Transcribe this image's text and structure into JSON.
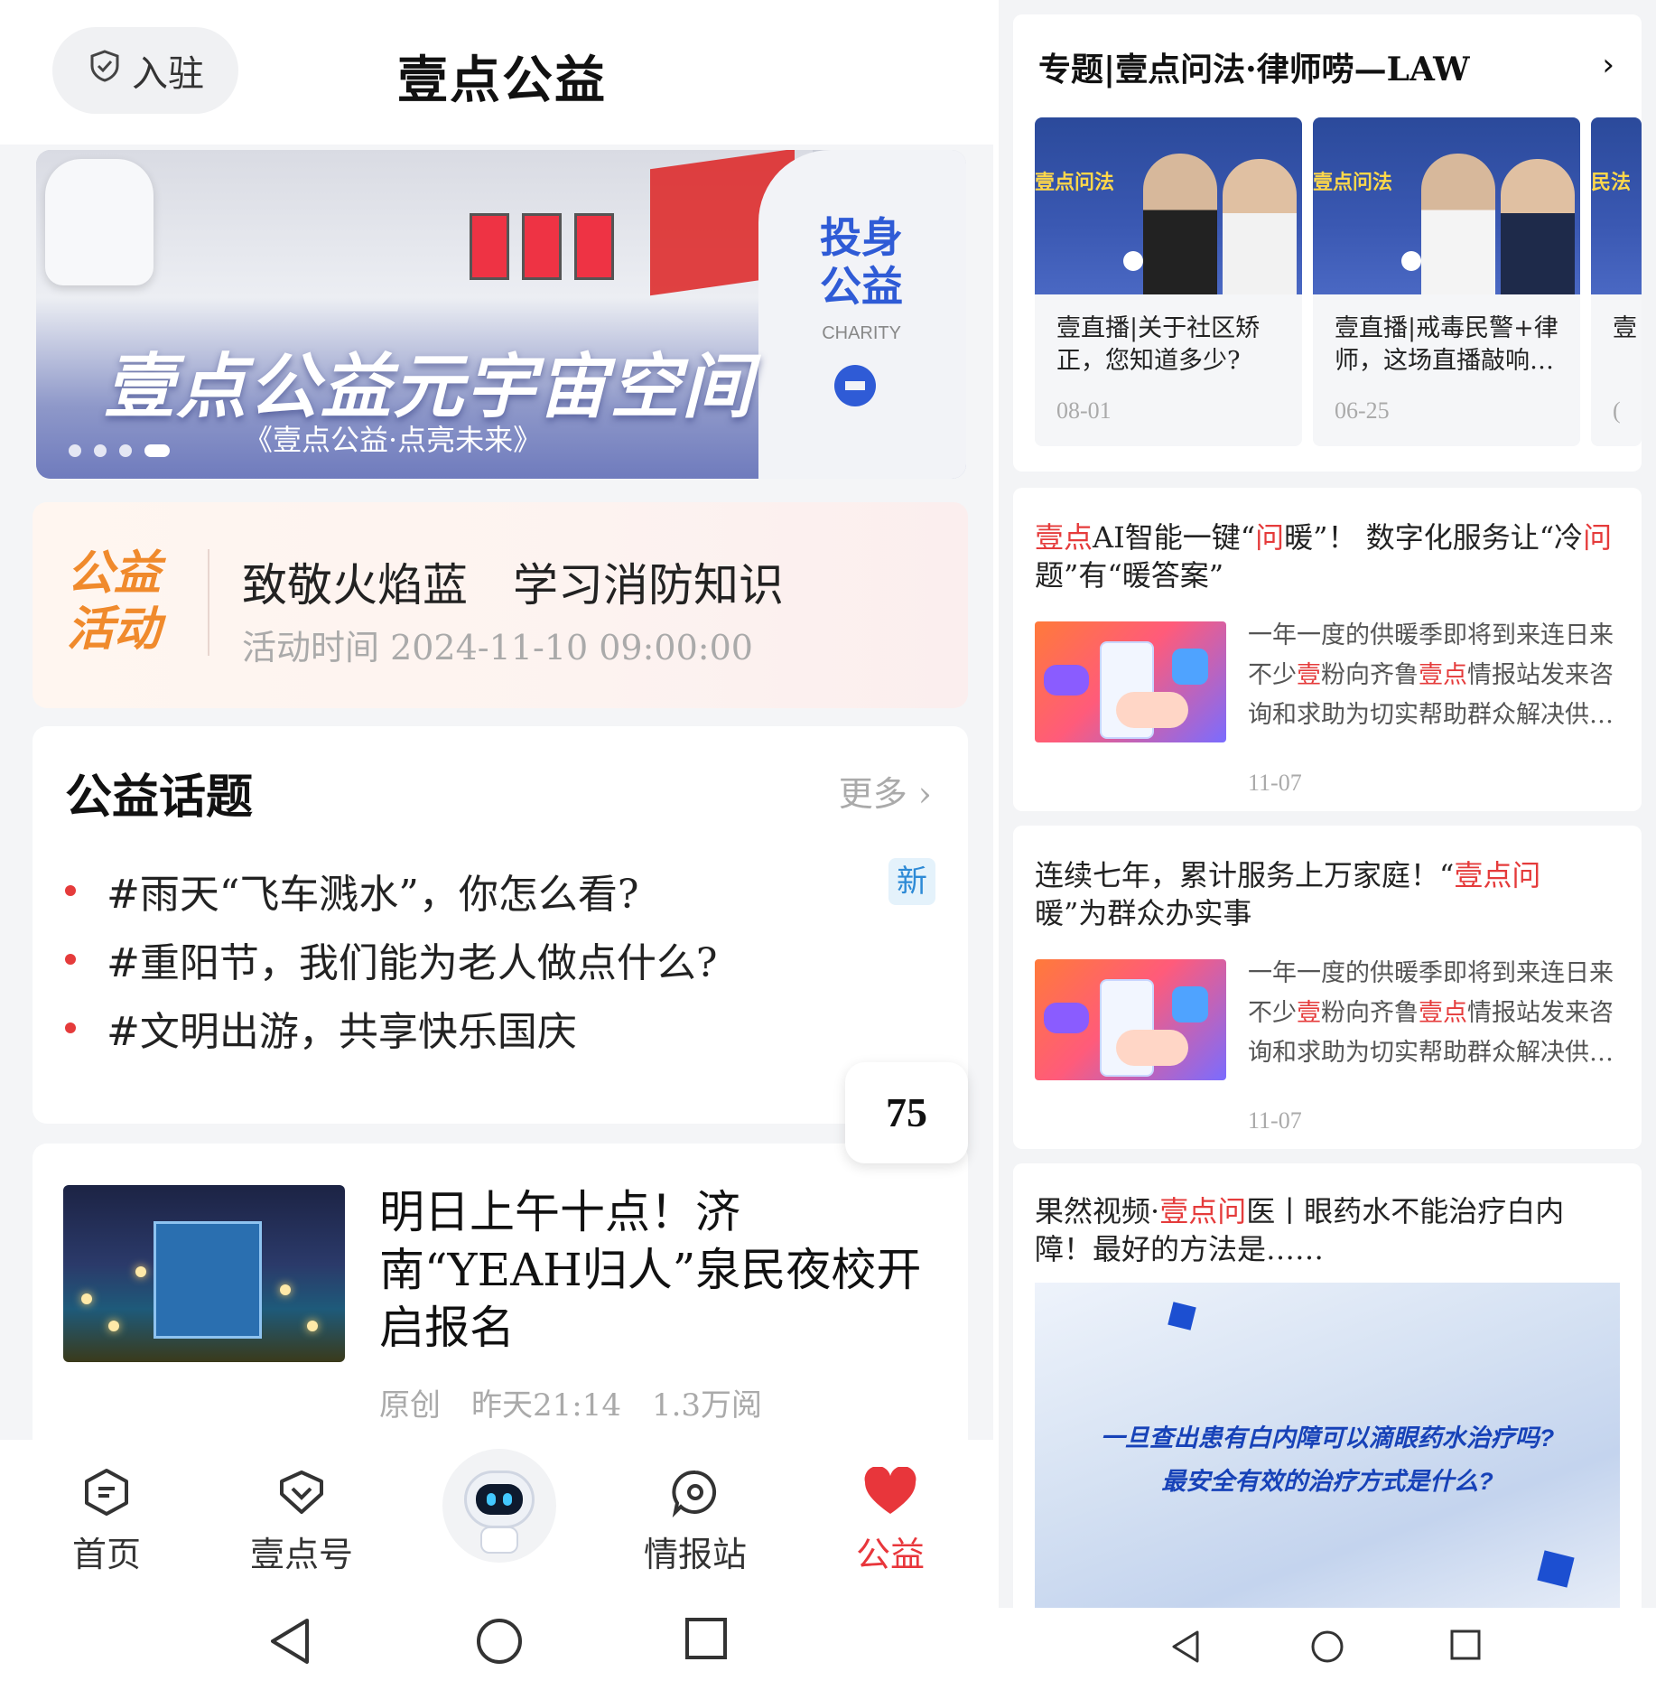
{
  "left": {
    "header": {
      "join_label": "入驻",
      "title": "壹点公益"
    },
    "banner": {
      "headline": "壹点公益元宇宙空间",
      "subtitle": "《壹点公益·点亮未来》",
      "side_title": "投身公益",
      "side_en": "CHARITY",
      "slides_total": 4,
      "active_slide": 4
    },
    "activity": {
      "tag": "公益活动",
      "title": "致敬火焰蓝　学习消防知识",
      "time": "活动时间 2024-11-10 09:00:00"
    },
    "topics": {
      "heading": "公益话题",
      "more": "更多",
      "new_badge": "新",
      "items": [
        "#雨天“飞车溅水”，你怎么看?",
        "#重阳节，我们能为老人做点什么?",
        "#文明出游，共享快乐国庆"
      ]
    },
    "bubble_count": "75",
    "news": {
      "title": "明日上午十点！济南“YEAH归人”泉民夜校开启报名",
      "meta": "原创　昨天21:14　1.3万阅"
    },
    "tabbar": [
      {
        "label": "首页",
        "icon": "home-icon"
      },
      {
        "label": "壹点号",
        "icon": "heart-shield-icon"
      },
      {
        "label": "",
        "icon": "robot-icon"
      },
      {
        "label": "情报站",
        "icon": "message-circle-icon"
      },
      {
        "label": "公益",
        "icon": "heart-icon"
      }
    ],
    "colors": {
      "accent": "#e8363b",
      "orange": "#f08a2c",
      "blue": "#2f5bd6"
    }
  },
  "right": {
    "topic_card": {
      "heading": "专题|壹点问法·律师唠—LAW",
      "videos": [
        {
          "thumb_label": "壹点问法",
          "caption": "壹直播|关于社区矫正，您知道多少?",
          "date": "08-01"
        },
        {
          "thumb_label": "壹点问法",
          "caption": "壹直播|戒毒民警+律师，这场直播敲响…",
          "date": "06-25"
        },
        {
          "thumb_label": "民法",
          "caption": "壹",
          "date": "("
        }
      ]
    },
    "articles": [
      {
        "title_parts": [
          "壹点",
          "AI智能一键“",
          "问",
          "暖”！ 数字化服务让“冷",
          "问",
          "题”有“暖答案”"
        ],
        "desc_parts": [
          "一年一度的供暖季即将到来连日来不少",
          "壹",
          "粉向齐鲁",
          "壹点",
          "情报站发来咨询和求助为切实帮助群众解决供…"
        ],
        "date": "11-07"
      },
      {
        "title_parts": [
          "连续七年，累计服务上万家庭！“",
          "壹点问",
          "暖”为群众办实事"
        ],
        "desc_parts": [
          "一年一度的供暖季即将到来连日来不少",
          "壹",
          "粉向齐鲁",
          "壹点",
          "情报站发来咨询和求助为切实帮助群众解决供…"
        ],
        "date": "11-07"
      }
    ],
    "video_article": {
      "title_parts": [
        "果然视频·",
        "壹点问",
        "医丨眼药水不能治疗白内障！最好的方法是……"
      ],
      "player_line1": "一旦查出患有白内障可以滴眼药水治疗吗?",
      "player_line2": "最安全有效的治疗方式是什么?"
    }
  }
}
